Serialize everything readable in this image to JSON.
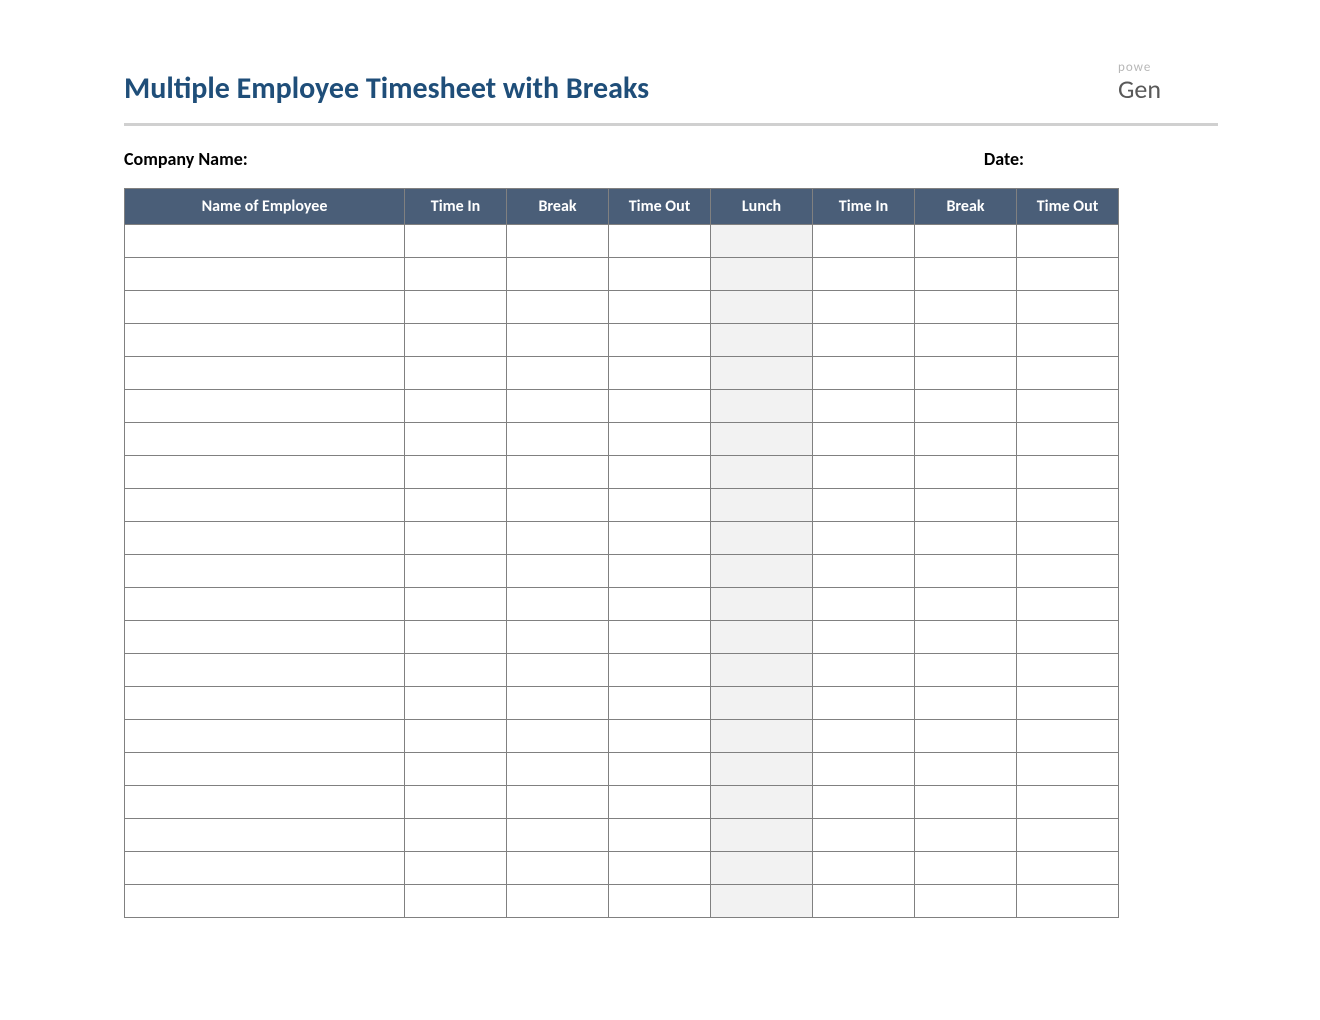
{
  "title": "Multiple Employee Timesheet with Breaks",
  "brand": {
    "powered_prefix": "powe",
    "name_fragment": "Gen"
  },
  "meta": {
    "company_label": "Company Name:",
    "date_label": "Date:"
  },
  "columns": [
    "Name of Employee",
    "Time In",
    "Break",
    "Time Out",
    "Lunch",
    "Time In",
    "Break",
    "Time Out"
  ],
  "row_count": 21,
  "rows": [
    [
      "",
      "",
      "",
      "",
      "",
      "",
      "",
      ""
    ],
    [
      "",
      "",
      "",
      "",
      "",
      "",
      "",
      ""
    ],
    [
      "",
      "",
      "",
      "",
      "",
      "",
      "",
      ""
    ],
    [
      "",
      "",
      "",
      "",
      "",
      "",
      "",
      ""
    ],
    [
      "",
      "",
      "",
      "",
      "",
      "",
      "",
      ""
    ],
    [
      "",
      "",
      "",
      "",
      "",
      "",
      "",
      ""
    ],
    [
      "",
      "",
      "",
      "",
      "",
      "",
      "",
      ""
    ],
    [
      "",
      "",
      "",
      "",
      "",
      "",
      "",
      ""
    ],
    [
      "",
      "",
      "",
      "",
      "",
      "",
      "",
      ""
    ],
    [
      "",
      "",
      "",
      "",
      "",
      "",
      "",
      ""
    ],
    [
      "",
      "",
      "",
      "",
      "",
      "",
      "",
      ""
    ],
    [
      "",
      "",
      "",
      "",
      "",
      "",
      "",
      ""
    ],
    [
      "",
      "",
      "",
      "",
      "",
      "",
      "",
      ""
    ],
    [
      "",
      "",
      "",
      "",
      "",
      "",
      "",
      ""
    ],
    [
      "",
      "",
      "",
      "",
      "",
      "",
      "",
      ""
    ],
    [
      "",
      "",
      "",
      "",
      "",
      "",
      "",
      ""
    ],
    [
      "",
      "",
      "",
      "",
      "",
      "",
      "",
      ""
    ],
    [
      "",
      "",
      "",
      "",
      "",
      "",
      "",
      ""
    ],
    [
      "",
      "",
      "",
      "",
      "",
      "",
      "",
      ""
    ],
    [
      "",
      "",
      "",
      "",
      "",
      "",
      "",
      ""
    ],
    [
      "",
      "",
      "",
      "",
      "",
      "",
      "",
      ""
    ]
  ]
}
